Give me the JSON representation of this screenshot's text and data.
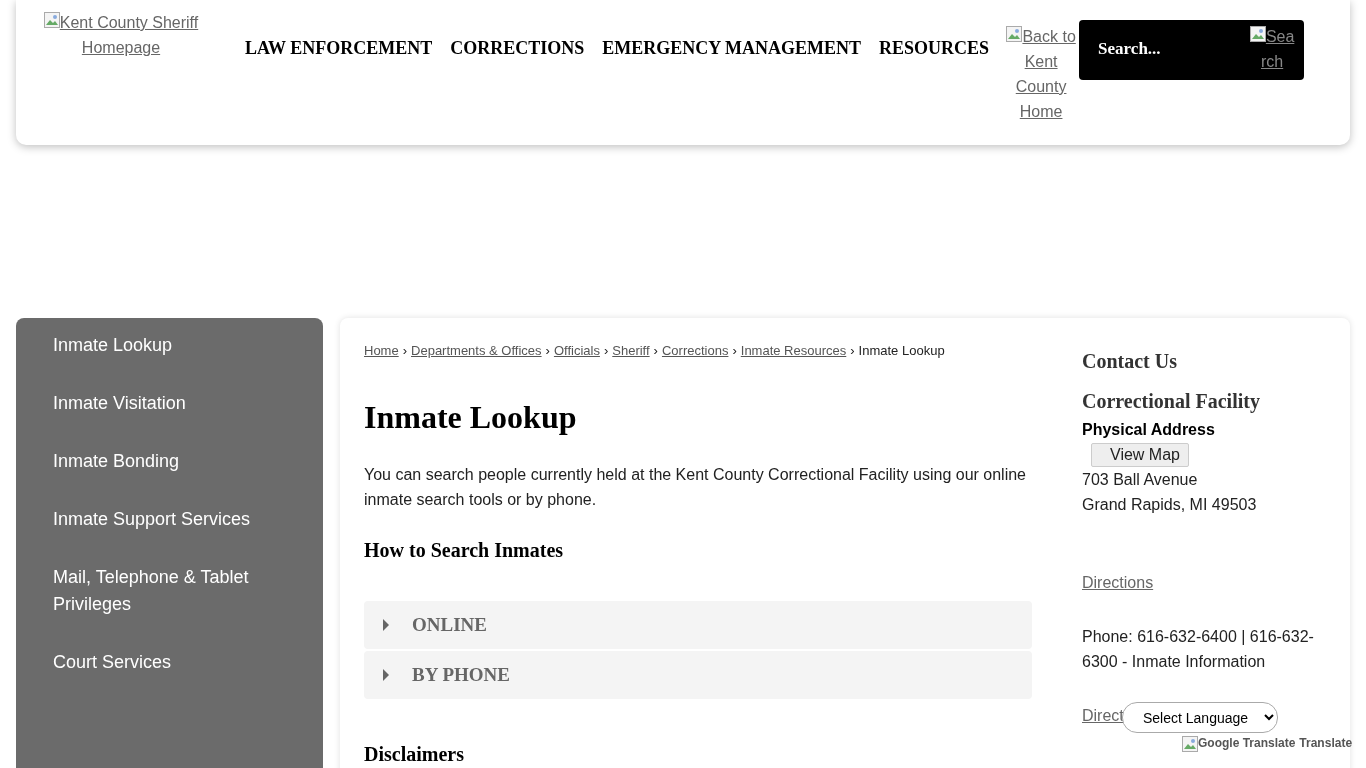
{
  "header": {
    "logo_alt": "Kent County Sheriff Homepage",
    "nav": [
      "LAW ENFORCEMENT",
      "CORRECTIONS",
      "EMERGENCY MANAGEMENT",
      "RESOURCES"
    ],
    "back_alt": "Back to Kent County Home",
    "search": {
      "placeholder": "Search...",
      "button_alt": "Sea rch"
    }
  },
  "sidebar": {
    "items": [
      {
        "label": "Inmate Lookup",
        "selected": false
      },
      {
        "label": "Inmate Visitation",
        "selected": false
      },
      {
        "label": "Inmate Bonding",
        "selected": false
      },
      {
        "label": "Inmate Support Services",
        "selected": false
      },
      {
        "label": "Mail, Telephone & Tablet Privileges",
        "selected": false
      },
      {
        "label": "Court Services",
        "selected": false
      }
    ]
  },
  "breadcrumb": {
    "links": [
      "Home",
      "Departments & Offices",
      "Officials",
      "Sheriff",
      "Corrections",
      "Inmate Resources"
    ],
    "current": "Inmate Lookup",
    "separator": "›"
  },
  "title": "Inmate Lookup",
  "intro": "You can search people currently held at the Kent County Correctional Facility using our online inmate search tools or by phone.",
  "section_heading": "How to Search Inmates",
  "accordion": [
    {
      "label": "ONLINE",
      "expanded": false
    },
    {
      "label": "BY PHONE",
      "expanded": false
    }
  ],
  "disclaimers_heading": "Disclaimers",
  "contact": {
    "heading": "Contact Us",
    "facility": "Correctional Facility",
    "address_label": "Physical Address",
    "map_button": "View Map",
    "address_lines": [
      "703 Ball Avenue",
      "Grand Rapids, MI 49503"
    ],
    "directions": "Directions",
    "phone": "Phone: 616-632-6400 | 616-632-6300 - Inmate Information",
    "directions_cut": "Direct"
  },
  "translate": {
    "select": "Select Language",
    "alt": "Google Translate",
    "label": "Translate"
  }
}
